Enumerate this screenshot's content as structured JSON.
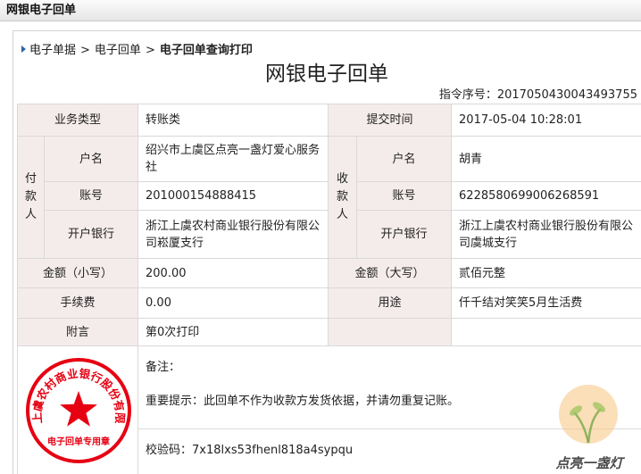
{
  "window": {
    "title": "网银电子回单"
  },
  "breadcrumb": {
    "item1": "电子单据",
    "item2": "电子回单",
    "current": "电子回单查询打印",
    "sep": ">"
  },
  "receipt": {
    "title": "网银电子回单",
    "serial_label": "指令序号：",
    "serial_value": "2017050430043493755",
    "biz_type_label": "业务类型",
    "biz_type_value": "转账类",
    "submit_time_label": "提交时间",
    "submit_time_value": "2017-05-04 10:28:01",
    "payer_label": [
      "付",
      "款",
      "人"
    ],
    "payee_label": [
      "收",
      "款",
      "人"
    ],
    "account_name_label": "户名",
    "account_no_label": "账号",
    "bank_label": "开户银行",
    "payer": {
      "name": "绍兴市上虞区点亮一盏灯爱心服务社",
      "account": "201000154888415",
      "bank": "浙江上虞农村商业银行股份有限公司崧厦支行"
    },
    "payee": {
      "name": "胡青",
      "account": "6228580699006268591",
      "bank": "浙江上虞农村商业银行股份有限公司虞城支行"
    },
    "amount_small_label": "金额（小写）",
    "amount_small_value": "200.00",
    "amount_big_label": "金额（大写）",
    "amount_big_value": "贰佰元整",
    "fee_label": "手续费",
    "fee_value": "0.00",
    "purpose_label": "用途",
    "purpose_value": "仟千结对笑笑5月生活费",
    "postscript_label": "附言",
    "postscript_value": "第0次打印",
    "remark_label": "备注：",
    "notice": "重要提示：此回单不作为收款方发货依据，并请勿重复记账。",
    "check_code": "校验码：7x18lxs53fhenl818a4sypqu"
  },
  "stamp": {
    "arc_text": "浙江上虞农村商业银行股份有限公司",
    "bottom_text": "电子回单专用章",
    "color": "#e60012"
  },
  "watermark": {
    "text": "点亮一盏灯"
  }
}
